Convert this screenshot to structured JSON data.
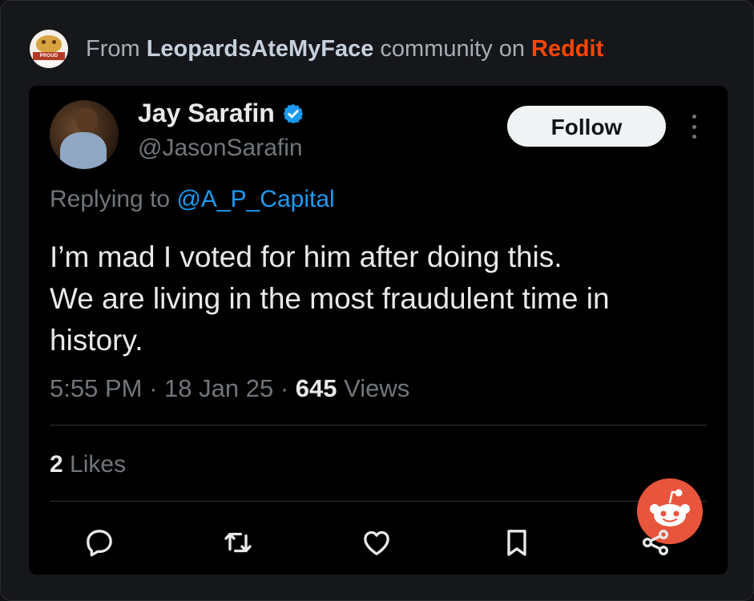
{
  "header": {
    "prefix": "From ",
    "subreddit": "LeopardsAteMyFace",
    "middle": " community on ",
    "platform": "Reddit",
    "logo_icon": "leopard-logo-icon",
    "logo_ribbon": "PROUD MEMBER"
  },
  "tweet": {
    "author_name": "Jay Sarafin",
    "handle": "@JasonSarafin",
    "verified_icon": "verified-badge-icon",
    "follow_label": "Follow",
    "replying_prefix": "Replying to ",
    "replying_to": "@A_P_Capital",
    "text_lines": [
      "I’m mad I voted for him after doing this.",
      "We are living in the most fraudulent time in",
      "history."
    ],
    "time": "5:55 PM",
    "date": "18 Jan 25",
    "views_count": "645",
    "views_label": "Views",
    "likes_count": "2",
    "likes_label": "Likes"
  },
  "actions": [
    "reply-icon",
    "retweet-icon",
    "like-icon",
    "bookmark-icon",
    "share-icon"
  ],
  "colors": {
    "accent_link": "#1d9bf0",
    "reddit": "#ff4500",
    "tweet_bg": "#000000",
    "frame_bg": "#16171a"
  }
}
